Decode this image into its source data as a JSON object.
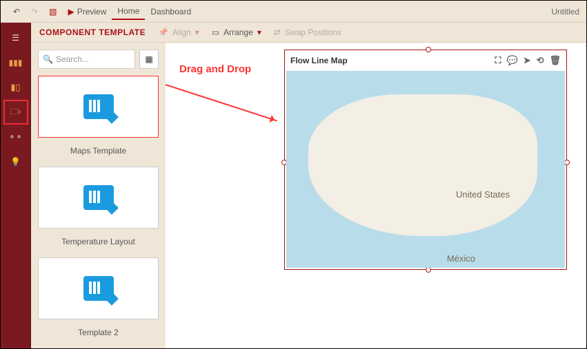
{
  "doc_title": "Untitled",
  "top": {
    "preview": "Preview",
    "home": "Home",
    "dashboard": "Dashboard"
  },
  "bar": {
    "title": "COMPONENT TEMPLATE",
    "align": "Align",
    "arrange": "Arrange",
    "swap": "Swap Positions"
  },
  "search": {
    "placeholder": "Search..."
  },
  "templates": [
    {
      "label": "Maps Template"
    },
    {
      "label": "Temperature Layout"
    },
    {
      "label": "Template 2"
    }
  ],
  "annotation": "Drag and Drop",
  "map": {
    "title": "Flow Line Map",
    "country": "United States",
    "neighbor": "México"
  }
}
